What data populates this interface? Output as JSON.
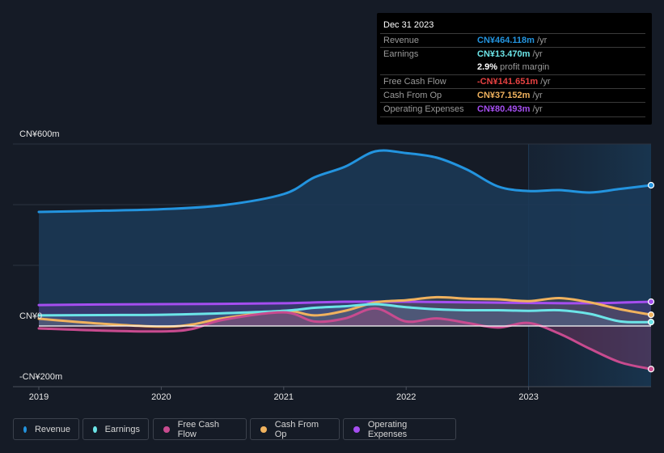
{
  "tooltip": {
    "date": "Dec 31 2023",
    "rows": [
      {
        "label": "Revenue",
        "value": "CN¥464.118m",
        "unit": " /yr",
        "color": "#2394df"
      },
      {
        "label": "Earnings",
        "value": "CN¥13.470m",
        "unit": " /yr",
        "color": "#6ce5e8"
      },
      {
        "label": "",
        "margin_value": "2.9%",
        "margin_text": " profit margin"
      },
      {
        "label": "Free Cash Flow",
        "value": "-CN¥141.651m",
        "unit": " /yr",
        "color": "#e64141"
      },
      {
        "label": "Cash From Op",
        "value": "CN¥37.152m",
        "unit": " /yr",
        "color": "#f0b25e"
      },
      {
        "label": "Operating Expenses",
        "value": "CN¥80.493m",
        "unit": " /yr",
        "color": "#a54ef0"
      }
    ]
  },
  "legend": [
    {
      "label": "Revenue",
      "color": "#2394df"
    },
    {
      "label": "Earnings",
      "color": "#6ce5e8"
    },
    {
      "label": "Free Cash Flow",
      "color": "#c84b8f"
    },
    {
      "label": "Cash From Op",
      "color": "#f0b25e"
    },
    {
      "label": "Operating Expenses",
      "color": "#a54ef0"
    }
  ],
  "chart_data": {
    "type": "area",
    "title": "",
    "xlabel": "",
    "ylabel": "",
    "units": "CN¥ millions",
    "ylim": [
      -200,
      600
    ],
    "xlim": [
      2019.0,
      2024.0
    ],
    "y_ticks": [
      {
        "value": 600,
        "label": "CN¥600m"
      },
      {
        "value": 0,
        "label": "CN¥0"
      },
      {
        "value": -200,
        "label": "-CN¥200m"
      }
    ],
    "y_gridlines": [
      600,
      400,
      200,
      0,
      -200
    ],
    "x_ticks": [
      {
        "value": 2019,
        "label": "2019"
      },
      {
        "value": 2020,
        "label": "2020"
      },
      {
        "value": 2021,
        "label": "2021"
      },
      {
        "value": 2022,
        "label": "2022"
      },
      {
        "value": 2023,
        "label": "2023"
      }
    ],
    "highlight_range": [
      2023.0,
      2024.0
    ],
    "grid": true,
    "legend_position": "bottom",
    "series": [
      {
        "name": "Revenue",
        "color": "#2394df",
        "x": [
          2019.0,
          2019.5,
          2020.0,
          2020.5,
          2021.0,
          2021.25,
          2021.5,
          2021.75,
          2022.0,
          2022.25,
          2022.5,
          2022.75,
          2023.0,
          2023.25,
          2023.5,
          2023.75,
          2024.0
        ],
        "values": [
          376,
          380,
          385,
          398,
          435,
          490,
          525,
          576,
          570,
          555,
          515,
          460,
          445,
          448,
          440,
          452,
          464
        ]
      },
      {
        "name": "Operating Expenses",
        "color": "#a54ef0",
        "x": [
          2019.0,
          2019.5,
          2020.0,
          2020.5,
          2021.0,
          2021.5,
          2022.0,
          2022.5,
          2023.0,
          2023.5,
          2024.0
        ],
        "values": [
          69,
          71,
          72,
          73,
          75,
          80,
          80,
          78,
          76,
          75,
          80
        ]
      },
      {
        "name": "Cash From Op",
        "color": "#f0b25e",
        "x": [
          2019.0,
          2019.5,
          2020.0,
          2020.25,
          2020.5,
          2021.0,
          2021.25,
          2021.5,
          2021.75,
          2022.0,
          2022.25,
          2022.5,
          2022.75,
          2023.0,
          2023.25,
          2023.5,
          2023.75,
          2024.0
        ],
        "values": [
          24,
          8,
          -2,
          5,
          25,
          50,
          35,
          50,
          78,
          85,
          95,
          90,
          88,
          82,
          92,
          78,
          55,
          37
        ]
      },
      {
        "name": "Earnings",
        "color": "#6ce5e8",
        "x": [
          2019.0,
          2019.5,
          2020.0,
          2020.5,
          2021.0,
          2021.25,
          2021.5,
          2021.75,
          2022.0,
          2022.25,
          2022.5,
          2022.75,
          2023.0,
          2023.25,
          2023.5,
          2023.75,
          2024.0
        ],
        "values": [
          35,
          36,
          37,
          42,
          50,
          60,
          65,
          72,
          62,
          55,
          52,
          52,
          50,
          52,
          40,
          15,
          13
        ]
      },
      {
        "name": "Free Cash Flow",
        "color": "#c84b8f",
        "x": [
          2019.0,
          2019.5,
          2020.0,
          2020.25,
          2020.5,
          2021.0,
          2021.25,
          2021.5,
          2021.75,
          2022.0,
          2022.25,
          2022.5,
          2022.75,
          2023.0,
          2023.25,
          2023.5,
          2023.75,
          2024.0
        ],
        "values": [
          -8,
          -15,
          -18,
          -10,
          20,
          45,
          15,
          25,
          58,
          15,
          25,
          10,
          -5,
          10,
          -25,
          -75,
          -120,
          -142
        ]
      }
    ]
  }
}
